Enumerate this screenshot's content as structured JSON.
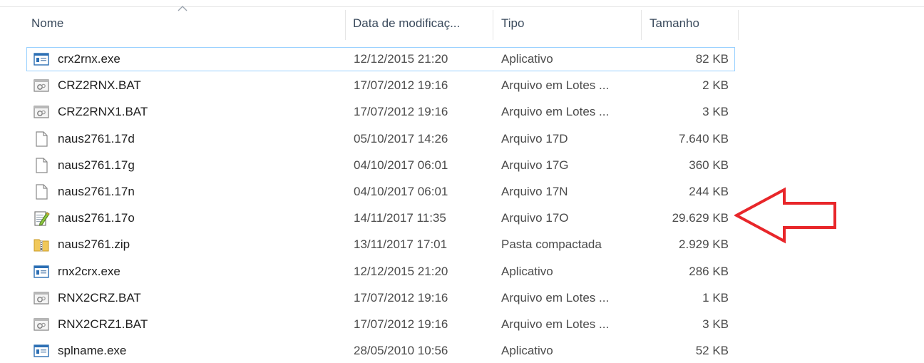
{
  "columns": {
    "name": "Nome",
    "date": "Data de modificaç...",
    "type": "Tipo",
    "size": "Tamanho"
  },
  "files": [
    {
      "name": "crx2rnx.exe",
      "date": "12/12/2015 21:20",
      "type": "Aplicativo",
      "size": "82 KB",
      "icon": "exe-icon",
      "selected": true
    },
    {
      "name": "CRZ2RNX.BAT",
      "date": "17/07/2012 19:16",
      "type": "Arquivo em Lotes ...",
      "size": "2 KB",
      "icon": "batch-file-icon"
    },
    {
      "name": "CRZ2RNX1.BAT",
      "date": "17/07/2012 19:16",
      "type": "Arquivo em Lotes ...",
      "size": "3 KB",
      "icon": "batch-file-icon"
    },
    {
      "name": "naus2761.17d",
      "date": "05/10/2017 14:26",
      "type": "Arquivo 17D",
      "size": "7.640 KB",
      "icon": "blank-file-icon"
    },
    {
      "name": "naus2761.17g",
      "date": "04/10/2017 06:01",
      "type": "Arquivo 17G",
      "size": "360 KB",
      "icon": "blank-file-icon"
    },
    {
      "name": "naus2761.17n",
      "date": "04/10/2017 06:01",
      "type": "Arquivo 17N",
      "size": "244 KB",
      "icon": "blank-file-icon"
    },
    {
      "name": "naus2761.17o",
      "date": "14/11/2017 11:35",
      "type": "Arquivo 17O",
      "size": "29.629 KB",
      "icon": "text-document-icon"
    },
    {
      "name": "naus2761.zip",
      "date": "13/11/2017 17:01",
      "type": "Pasta compactada",
      "size": "2.929 KB",
      "icon": "zip-folder-icon"
    },
    {
      "name": "rnx2crx.exe",
      "date": "12/12/2015 21:20",
      "type": "Aplicativo",
      "size": "286 KB",
      "icon": "exe-icon"
    },
    {
      "name": "RNX2CRZ.BAT",
      "date": "17/07/2012 19:16",
      "type": "Arquivo em Lotes ...",
      "size": "1 KB",
      "icon": "batch-file-icon"
    },
    {
      "name": "RNX2CRZ1.BAT",
      "date": "17/07/2012 19:16",
      "type": "Arquivo em Lotes ...",
      "size": "3 KB",
      "icon": "batch-file-icon"
    },
    {
      "name": "splname.exe",
      "date": "28/05/2010 10:56",
      "type": "Aplicativo",
      "size": "52 KB",
      "icon": "exe-icon"
    }
  ],
  "colors": {
    "selection_border": "#99d1ff",
    "annotation_arrow": "#e8262a"
  }
}
